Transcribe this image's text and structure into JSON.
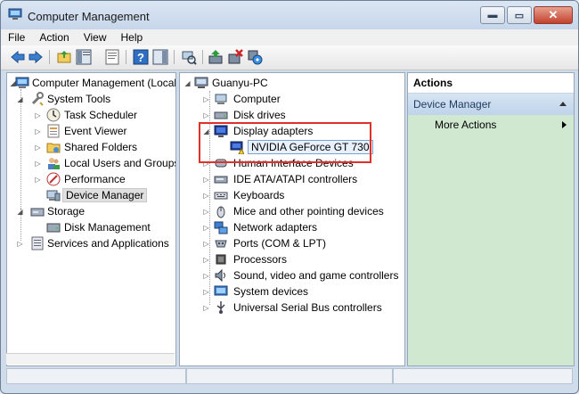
{
  "window": {
    "title": "Computer Management",
    "icons": [
      "computer-management-icon",
      "minimize-icon",
      "maximize-icon",
      "close-icon"
    ],
    "controls": {
      "minimize": "▬",
      "maximize": "▭",
      "close": "✕"
    }
  },
  "menu": [
    "File",
    "Action",
    "View",
    "Help"
  ],
  "toolbar": {
    "icons": [
      "back-arrow-icon",
      "forward-arrow-icon",
      "up-folder-icon",
      "show-hide-tree-icon",
      "properties-icon",
      "help-icon",
      "show-hide-action-pane-icon",
      "scan-hardware-icon",
      "update-driver-icon",
      "uninstall-icon",
      "enable-device-icon"
    ]
  },
  "left_tree": {
    "root": "Computer Management (Local",
    "system_tools": "System Tools",
    "task_scheduler": "Task Scheduler",
    "event_viewer": "Event Viewer",
    "shared_folders": "Shared Folders",
    "local_users": "Local Users and Groups",
    "performance": "Performance",
    "device_manager": "Device Manager",
    "storage": "Storage",
    "disk_management": "Disk Management",
    "services": "Services and Applications"
  },
  "device_tree": {
    "root": "Guanyu-PC",
    "computer": "Computer",
    "disk_drives": "Disk drives",
    "display_adapters": "Display adapters",
    "nvidia": "NVIDIA GeForce GT 730",
    "hid": "Human Interface Devices",
    "ide": "IDE ATA/ATAPI controllers",
    "keyboards": "Keyboards",
    "mice": "Mice and other pointing devices",
    "network": "Network adapters",
    "ports": "Ports (COM & LPT)",
    "processors": "Processors",
    "sound": "Sound, video and game controllers",
    "system_devices": "System devices",
    "usb": "Universal Serial Bus controllers"
  },
  "actions": {
    "header": "Actions",
    "section": "Device Manager",
    "more": "More Actions"
  },
  "colors": {
    "highlight_box": "#e0302a",
    "actions_bg": "#d0e8cf",
    "section_bg": "#c8dbef"
  }
}
